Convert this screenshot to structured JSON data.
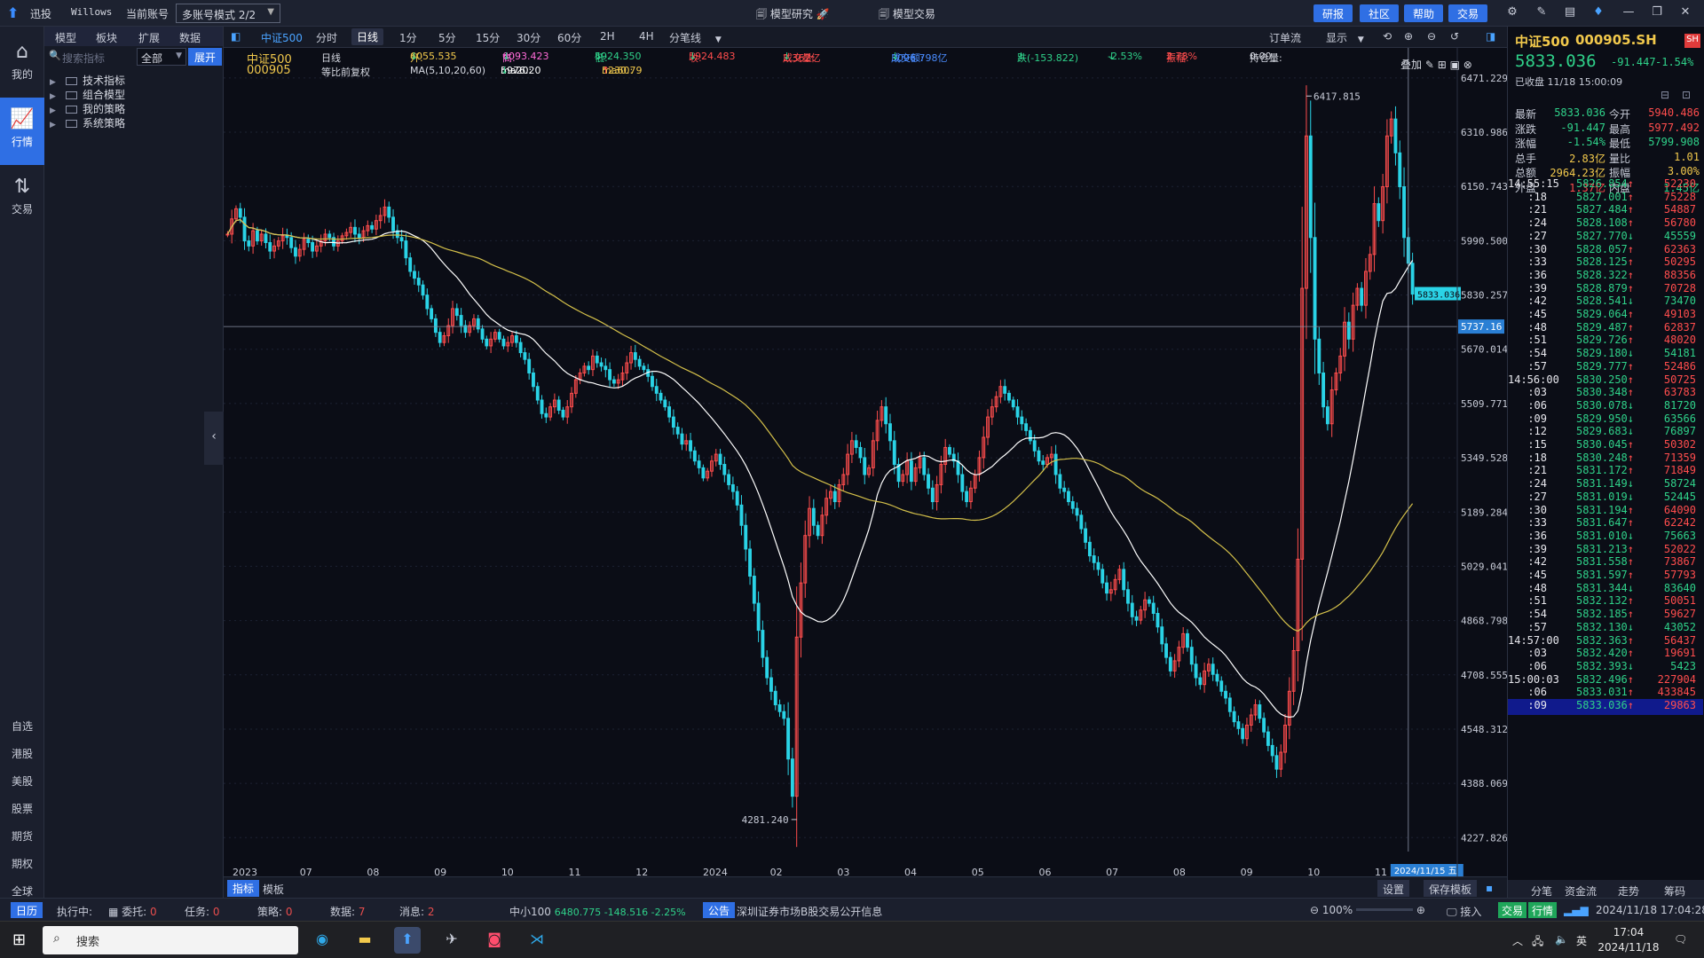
{
  "titlebar": {
    "app_name": "迅投",
    "user": "Willows",
    "account_label": "当前账号",
    "account_mode": "多账号模式 2/2",
    "center_tab1": "模型研究",
    "center_tab2": "模型交易",
    "buttons": [
      "研报",
      "社区",
      "帮助",
      "交易"
    ]
  },
  "leftnav": {
    "items": [
      {
        "icon": "home-icon",
        "label": "我的"
      },
      {
        "icon": "chart-icon",
        "label": "行情"
      },
      {
        "icon": "trade-icon",
        "label": "交易"
      }
    ],
    "markets": [
      "自选",
      "港股",
      "美股",
      "股票",
      "期货",
      "期权",
      "全球"
    ]
  },
  "indicator_panel": {
    "tabs": [
      "模型",
      "板块",
      "扩展",
      "数据"
    ],
    "search_placeholder": "搜索指标",
    "filter": "全部",
    "expand_button": "展开",
    "tree": [
      "技术指标",
      "组合模型",
      "我的策略",
      "系统策略"
    ]
  },
  "chartbar": {
    "symbol": "中证500",
    "periods": [
      "分时",
      "日线",
      "1分",
      "5分",
      "15分",
      "30分",
      "60分",
      "2H",
      "4H",
      "分笔线"
    ],
    "active_period": "日线",
    "right_items": [
      "订单流",
      "显示"
    ]
  },
  "chart_info": {
    "name": "中证500",
    "code": "000905",
    "period": "日线",
    "adjust": "等比前复权",
    "open_label": "开:",
    "open": "6055.535",
    "high_label": "高:",
    "high": "6093.423",
    "low_label": "低:",
    "low": "5924.350",
    "close_label": "收:",
    "close": "5924.483",
    "volume_label": "成交量:",
    "volume": "2.362亿",
    "amount_label": "成交额:",
    "amount": "3096.798亿",
    "change_label": "跌(-153.822)",
    "change_pct": "-2.53%",
    "amplitude_label": "振幅:",
    "amplitude": "2.78%",
    "position_label": "持仓量:",
    "position": "0.00",
    "ma_label": "MA(5,10,20,60)",
    "ma20_label": "ma20:",
    "ma20": "5976.20",
    "ma60_label": "ma60:",
    "ma60": "5230.79",
    "overlay_label": "叠加"
  },
  "chart_data": {
    "type": "candlestick",
    "x_axis_labels": [
      "2023",
      "07",
      "08",
      "09",
      "10",
      "11",
      "12",
      "2024",
      "02",
      "03",
      "04",
      "05",
      "06",
      "07",
      "08",
      "09",
      "10",
      "11"
    ],
    "y_ticks": [
      6471.229,
      6310.986,
      6150.743,
      5990.5,
      5830.257,
      5670.014,
      5509.771,
      5349.528,
      5189.284,
      5029.041,
      4868.798,
      4708.555,
      4548.312,
      4388.069,
      4227.826
    ],
    "ylim": [
      4150,
      6560
    ],
    "annotations": [
      {
        "label": "6417.815",
        "value": 6417.815,
        "kind": "max"
      },
      {
        "label": "4281.240",
        "value": 4281.24,
        "kind": "min"
      }
    ],
    "current_price_tag": "5833.036",
    "crosshair_price_tag": "5737.16",
    "crosshair_date_tag": "2024/11/15 五",
    "ma_series": [
      {
        "name": "ma20",
        "color": "#ffffff"
      },
      {
        "name": "ma60",
        "color": "#d4c04a"
      }
    ],
    "series": [
      {
        "name": "close",
        "values": [
          6010,
          6055,
          6085,
          6060,
          5990,
          5975,
          6020,
          5990,
          6010,
          5985,
          5960,
          5975,
          5990,
          6005,
          6000,
          5970,
          5945,
          5965,
          5995,
          5985,
          5960,
          5975,
          5990,
          6010,
          6000,
          5975,
          5990,
          6005,
          6015,
          6030,
          6010,
          6000,
          6020,
          6035,
          6025,
          6050,
          6065,
          6090,
          6060,
          6020,
          6000,
          5990,
          5940,
          5900,
          5880,
          5860,
          5830,
          5790,
          5760,
          5720,
          5690,
          5710,
          5740,
          5790,
          5770,
          5740,
          5720,
          5740,
          5760,
          5730,
          5700,
          5680,
          5700,
          5720,
          5700,
          5680,
          5690,
          5710,
          5690,
          5660,
          5640,
          5600,
          5560,
          5520,
          5480,
          5470,
          5500,
          5520,
          5490,
          5470,
          5500,
          5540,
          5580,
          5600,
          5620,
          5610,
          5650,
          5630,
          5620,
          5610,
          5580,
          5570,
          5580,
          5600,
          5630,
          5660,
          5640,
          5620,
          5610,
          5590,
          5560,
          5540,
          5520,
          5500,
          5470,
          5440,
          5420,
          5390,
          5400,
          5370,
          5340,
          5320,
          5290,
          5310,
          5340,
          5360,
          5330,
          5300,
          5270,
          5250,
          5210,
          5150,
          5080,
          5000,
          4920,
          4840,
          4760,
          4700,
          4660,
          4620,
          4600,
          4580,
          4460,
          4350,
          4820,
          4980,
          5120,
          5200,
          5150,
          5120,
          5180,
          5230,
          5250,
          5220,
          5270,
          5300,
          5360,
          5400,
          5380,
          5350,
          5300,
          5320,
          5400,
          5460,
          5500,
          5450,
          5400,
          5330,
          5280,
          5300,
          5340,
          5280,
          5320,
          5350,
          5300,
          5260,
          5220,
          5270,
          5330,
          5380,
          5360,
          5340,
          5300,
          5250,
          5220,
          5260,
          5300,
          5350,
          5410,
          5470,
          5500,
          5530,
          5560,
          5540,
          5520,
          5500,
          5470,
          5450,
          5430,
          5400,
          5370,
          5340,
          5330,
          5350,
          5360,
          5300,
          5260,
          5250,
          5220,
          5200,
          5180,
          5140,
          5100,
          5060,
          5040,
          5020,
          4980,
          4950,
          4960,
          4990,
          5020,
          4960,
          4920,
          4880,
          4870,
          4900,
          4930,
          4920,
          4890,
          4850,
          4800,
          4760,
          4720,
          4750,
          4790,
          4830,
          4790,
          4740,
          4700,
          4680,
          4720,
          4740,
          4710,
          4690,
          4660,
          4640,
          4600,
          4570,
          4550,
          4520,
          4560,
          4590,
          4620,
          4580,
          4540,
          4500,
          4470,
          4430,
          4480,
          4560,
          4660,
          4780,
          5050,
          5850,
          6300,
          6000,
          5700,
          5600,
          5500,
          5450,
          5550,
          5600,
          5650,
          5750,
          5700,
          5800,
          5850,
          5800,
          5900,
          5950,
          6100,
          6050,
          6150,
          6300,
          6350,
          6250,
          6150,
          6000,
          5924,
          5833
        ]
      }
    ]
  },
  "quote": {
    "name": "中证500",
    "code": "000905.SH",
    "exchange_badge": "SH",
    "price": "5833.036",
    "change": "-91.447",
    "change_pct": "-1.54%",
    "status": "已收盘",
    "datetime": "11/18  15:00:09",
    "rows": [
      {
        "l1": "最新",
        "v1": "5833.036",
        "c1": "#2fd28a",
        "l2": "今开",
        "v2": "5940.486",
        "c2": "#ff4d4d"
      },
      {
        "l1": "涨跌",
        "v1": "-91.447",
        "c1": "#2fd28a",
        "l2": "最高",
        "v2": "5977.492",
        "c2": "#ff4d4d"
      },
      {
        "l1": "涨幅",
        "v1": "-1.54%",
        "c1": "#2fd28a",
        "l2": "最低",
        "v2": "5799.908",
        "c2": "#2fd28a"
      },
      {
        "l1": "总手",
        "v1": "2.83亿",
        "c1": "#f2c94c",
        "l2": "量比",
        "v2": "1.01",
        "c2": "#f2c94c"
      },
      {
        "l1": "总额",
        "v1": "2964.23亿",
        "c1": "#f2c94c",
        "l2": "振幅",
        "v2": "3.00%",
        "c2": "#f2c94c"
      },
      {
        "l1": "外盘",
        "v1": "1.37亿",
        "c1": "#ff4d4d",
        "l2": "内盘",
        "v2": "1.45亿",
        "c2": "#2fd28a"
      }
    ],
    "ticks": [
      {
        "t": "14:55:15",
        "p": "5826.854",
        "d": "↑",
        "v": "52230"
      },
      {
        "t": ":18",
        "p": "5827.001",
        "d": "↑",
        "v": "75228"
      },
      {
        "t": ":21",
        "p": "5827.484",
        "d": "↑",
        "v": "54887"
      },
      {
        "t": ":24",
        "p": "5828.108",
        "d": "↑",
        "v": "56780"
      },
      {
        "t": ":27",
        "p": "5827.770",
        "d": "↓",
        "v": "45559"
      },
      {
        "t": ":30",
        "p": "5828.057",
        "d": "↑",
        "v": "62363"
      },
      {
        "t": ":33",
        "p": "5828.125",
        "d": "↑",
        "v": "50295"
      },
      {
        "t": ":36",
        "p": "5828.322",
        "d": "↑",
        "v": "88356"
      },
      {
        "t": ":39",
        "p": "5828.879",
        "d": "↑",
        "v": "70728"
      },
      {
        "t": ":42",
        "p": "5828.541",
        "d": "↓",
        "v": "73470"
      },
      {
        "t": ":45",
        "p": "5829.064",
        "d": "↑",
        "v": "49103"
      },
      {
        "t": ":48",
        "p": "5829.487",
        "d": "↑",
        "v": "62837"
      },
      {
        "t": ":51",
        "p": "5829.726",
        "d": "↑",
        "v": "48020"
      },
      {
        "t": ":54",
        "p": "5829.180",
        "d": "↓",
        "v": "54181"
      },
      {
        "t": ":57",
        "p": "5829.777",
        "d": "↑",
        "v": "52486"
      },
      {
        "t": "14:56:00",
        "p": "5830.250",
        "d": "↑",
        "v": "50725"
      },
      {
        "t": ":03",
        "p": "5830.348",
        "d": "↑",
        "v": "63783"
      },
      {
        "t": ":06",
        "p": "5830.078",
        "d": "↓",
        "v": "81720"
      },
      {
        "t": ":09",
        "p": "5829.950",
        "d": "↓",
        "v": "63566"
      },
      {
        "t": ":12",
        "p": "5829.683",
        "d": "↓",
        "v": "76897"
      },
      {
        "t": ":15",
        "p": "5830.045",
        "d": "↑",
        "v": "50302"
      },
      {
        "t": ":18",
        "p": "5830.248",
        "d": "↑",
        "v": "71359"
      },
      {
        "t": ":21",
        "p": "5831.172",
        "d": "↑",
        "v": "71849"
      },
      {
        "t": ":24",
        "p": "5831.149",
        "d": "↓",
        "v": "58724"
      },
      {
        "t": ":27",
        "p": "5831.019",
        "d": "↓",
        "v": "52445"
      },
      {
        "t": ":30",
        "p": "5831.194",
        "d": "↑",
        "v": "64090"
      },
      {
        "t": ":33",
        "p": "5831.647",
        "d": "↑",
        "v": "62242"
      },
      {
        "t": ":36",
        "p": "5831.010",
        "d": "↓",
        "v": "75663"
      },
      {
        "t": ":39",
        "p": "5831.213",
        "d": "↑",
        "v": "52022"
      },
      {
        "t": ":42",
        "p": "5831.558",
        "d": "↑",
        "v": "73867"
      },
      {
        "t": ":45",
        "p": "5831.597",
        "d": "↑",
        "v": "57793"
      },
      {
        "t": ":48",
        "p": "5831.344",
        "d": "↓",
        "v": "83640"
      },
      {
        "t": ":51",
        "p": "5832.132",
        "d": "↑",
        "v": "50051"
      },
      {
        "t": ":54",
        "p": "5832.185",
        "d": "↑",
        "v": "59627"
      },
      {
        "t": ":57",
        "p": "5832.130",
        "d": "↓",
        "v": "43052"
      },
      {
        "t": "14:57:00",
        "p": "5832.363",
        "d": "↑",
        "v": "56437"
      },
      {
        "t": ":03",
        "p": "5832.420",
        "d": "↑",
        "v": "19691"
      },
      {
        "t": ":06",
        "p": "5832.393",
        "d": "↓",
        "v": "5423"
      },
      {
        "t": "15:00:03",
        "p": "5832.496",
        "d": "↑",
        "v": "227904"
      },
      {
        "t": ":06",
        "p": "5833.031",
        "d": "↑",
        "v": "433845"
      },
      {
        "t": ":09",
        "p": "5833.036",
        "d": "↑",
        "v": "29863"
      }
    ],
    "tabs": [
      "分笔",
      "资金流",
      "走势",
      "筹码"
    ]
  },
  "bottombar": {
    "tabs": [
      "指标",
      "模板"
    ],
    "settings": "设置",
    "save_template": "保存模板"
  },
  "statusbar": {
    "calendar": "日历",
    "executing": "执行中:",
    "entrust_label": "委托:",
    "entrust": "0",
    "task_label": "任务:",
    "task": "0",
    "strategy_label": "策略:",
    "strategy": "0",
    "data_label": "数据:",
    "data": "7",
    "message_label": "消息:",
    "message": "2",
    "index_name": "中小100",
    "index_value": "6480.775 -148.516 -2.25%",
    "notice_badge": "公告",
    "notice_text": "深圳证券市场B股交易公开信息",
    "zoom": "100%",
    "access": "接入",
    "trade": "交易",
    "quote": "行情",
    "datetime": "2024/11/18 17:04:28"
  },
  "taskbar": {
    "search": "搜索",
    "time": "17:04",
    "date": "2024/11/18",
    "lang": "英"
  },
  "colors": {
    "up": "#ff4d4d",
    "down": "#2ad3e6",
    "accent": "#2f6fe4",
    "background": "#0b0d16"
  }
}
